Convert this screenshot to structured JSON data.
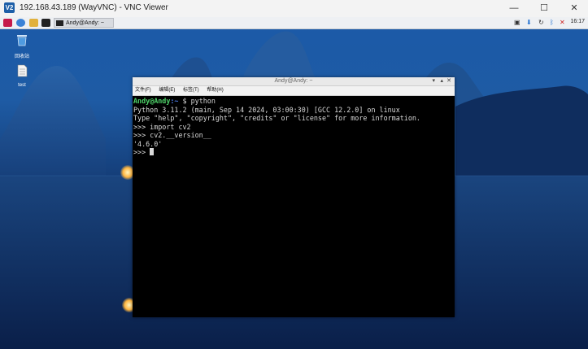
{
  "window": {
    "title": "192.168.43.189 (WayVNC) - VNC Viewer",
    "logo_text": "V2",
    "controls": {
      "minimize": "—",
      "maximize": "☐",
      "close": "✕"
    }
  },
  "panel": {
    "taskbar_button_label": "Andy@Andy: ~",
    "clock": "16:17",
    "icons": [
      "raspberry-menu-icon",
      "browser-icon",
      "file-manager-icon",
      "terminal-icon"
    ],
    "tray_icons": [
      "vnc-tray-icon",
      "download-icon",
      "sync-icon",
      "bluetooth-icon",
      "wifi-icon",
      "volume-icon",
      "eject-icon"
    ]
  },
  "desktop": {
    "icons": [
      {
        "label": "回收站",
        "icon": "trash-icon"
      },
      {
        "label": "test",
        "icon": "file-icon"
      }
    ]
  },
  "terminal": {
    "title": "Andy@Andy: ~",
    "controls": {
      "minimize": "▾",
      "maximize": "▴",
      "close": "✕"
    },
    "menu": [
      "文件(F)",
      "编辑(E)",
      "标签(T)",
      "帮助(H)"
    ],
    "prompt_user": "Andy@Andy",
    "prompt_path": ":~",
    "prompt_symbol": " $ ",
    "command": "python",
    "lines": [
      "Python 3.11.2 (main, Sep 14 2024, 03:00:30) [GCC 12.2.0] on linux",
      "Type \"help\", \"copyright\", \"credits\" or \"license\" for more information.",
      ">>> import cv2",
      ">>> cv2.__version__",
      "'4.6.0'"
    ],
    "current_prompt": ">>> "
  }
}
